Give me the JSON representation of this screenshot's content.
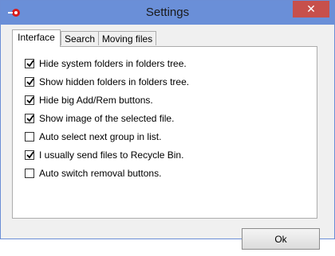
{
  "window": {
    "title": "Settings"
  },
  "tabs": [
    {
      "label": "Interface",
      "active": true
    },
    {
      "label": "Search",
      "active": false
    },
    {
      "label": "Moving files",
      "active": false
    }
  ],
  "options": [
    {
      "label": "Hide system folders in folders tree.",
      "checked": true
    },
    {
      "label": "Show hidden folders in folders tree.",
      "checked": true
    },
    {
      "label": "Hide big Add/Rem buttons.",
      "checked": true
    },
    {
      "label": "Show image of the selected file.",
      "checked": true
    },
    {
      "label": "Auto select next group in list.",
      "checked": false
    },
    {
      "label": "I usually send files to Recycle Bin.",
      "checked": true
    },
    {
      "label": "Auto switch removal buttons.",
      "checked": false
    }
  ],
  "buttons": {
    "ok_label": "Ok"
  },
  "icons": {
    "app": "app-icon",
    "close": "close-icon"
  },
  "colors": {
    "titlebar": "#6a8fd8",
    "close": "#c7504b"
  }
}
